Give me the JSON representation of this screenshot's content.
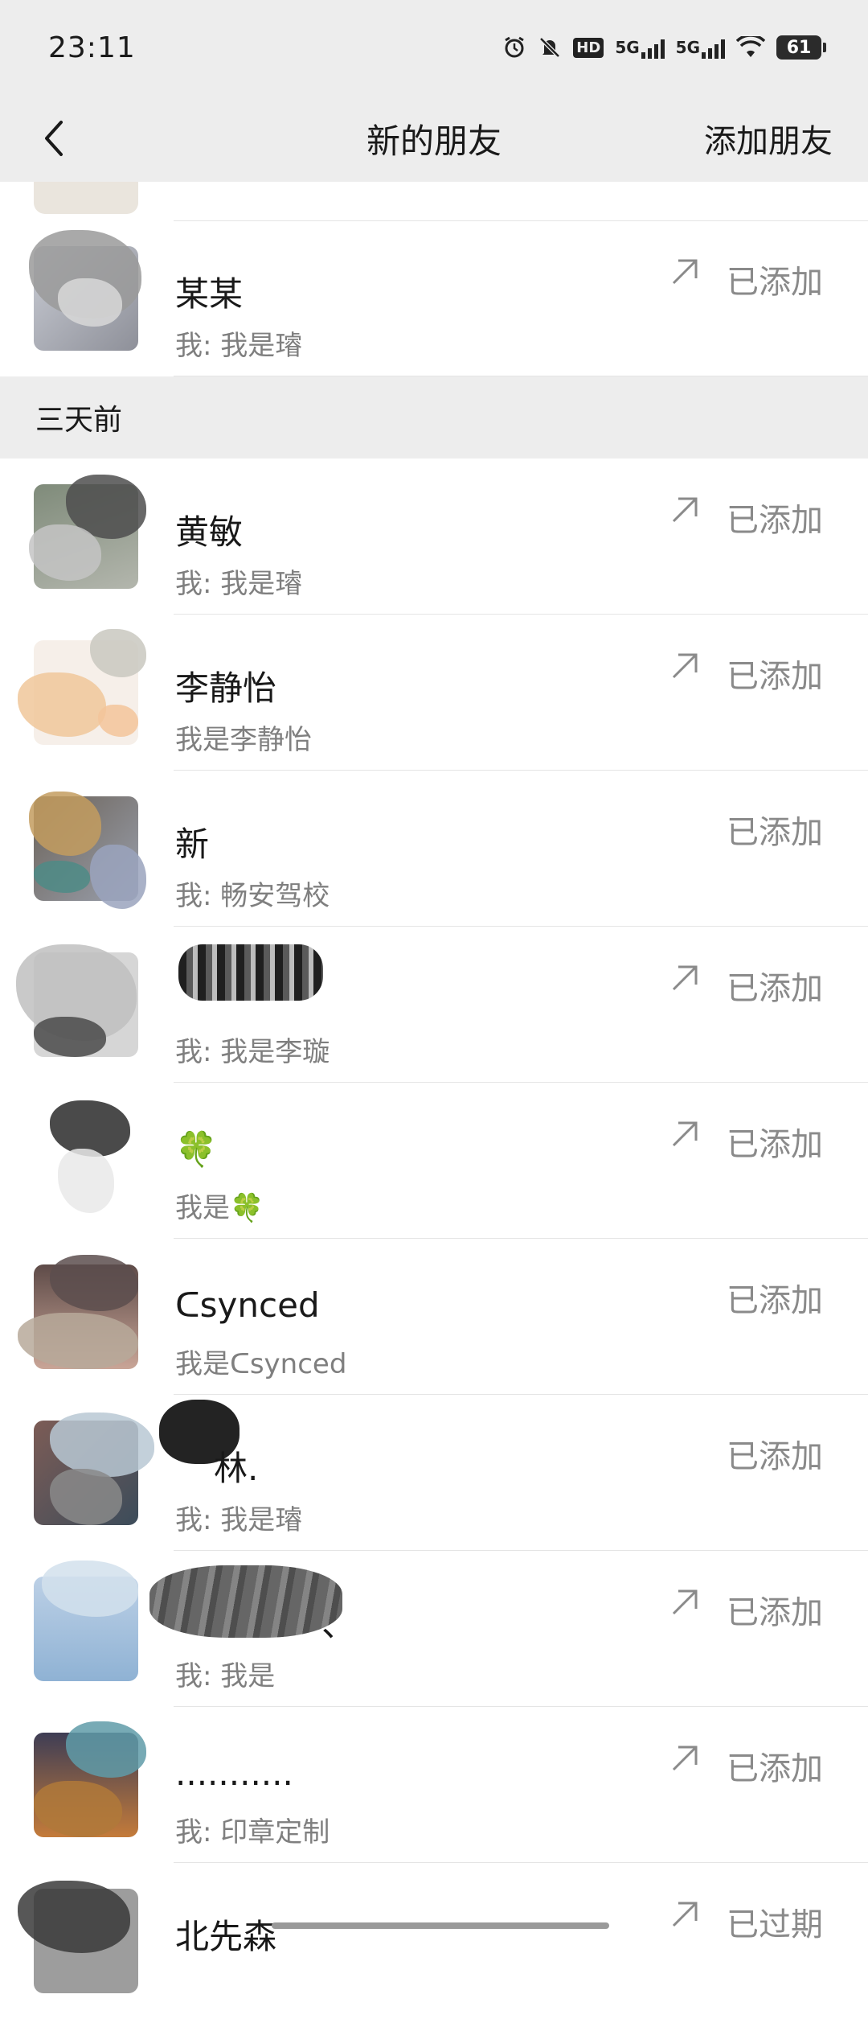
{
  "status_bar": {
    "time": "23:11",
    "icons": [
      "alarm-icon",
      "bell-muted-icon",
      "hd-icon",
      "5g-signal-icon",
      "5g-signal-icon",
      "wifi-icon"
    ],
    "hd_label": "HD",
    "net_label_1": "5G",
    "net_label_2": "5G",
    "battery": "61"
  },
  "nav": {
    "title": "新的朋友",
    "action": "添加朋友"
  },
  "section": {
    "header": "三天前"
  },
  "rows": [
    {
      "name": "某某",
      "message": "我: 我是璿",
      "status": "已添加",
      "arrow": true
    },
    {
      "name": "黄敏",
      "message": "我: 我是璿",
      "status": "已添加",
      "arrow": true
    },
    {
      "name": "李静怡",
      "message": "我是李静怡",
      "status": "已添加",
      "arrow": true
    },
    {
      "name": "新",
      "message": "我: 畅安驾校",
      "status": "已添加",
      "arrow": false
    },
    {
      "name": "",
      "message": "我: 我是李璇",
      "status": "已添加",
      "arrow": true
    },
    {
      "name": "🍀",
      "message": "我是🍀",
      "status": "已添加",
      "arrow": true
    },
    {
      "name": "ᑕsynced",
      "message": "我是ᑕsynced",
      "status": "已添加",
      "arrow": false
    },
    {
      "name": "林.",
      "message": "我: 我是璿",
      "status": "已添加",
      "arrow": false
    },
    {
      "name": "、",
      "message": "我: 我是",
      "status": "已添加",
      "arrow": true
    },
    {
      "name": "...........",
      "message": "我: 印章定制",
      "status": "已添加",
      "arrow": true
    },
    {
      "name": "北先森",
      "message": "",
      "status": "已过期",
      "arrow": true
    }
  ],
  "colors": {
    "nav_bg": "#ededed",
    "status_text": "#8a8a8a",
    "secondary_text": "#7f7f7f"
  }
}
